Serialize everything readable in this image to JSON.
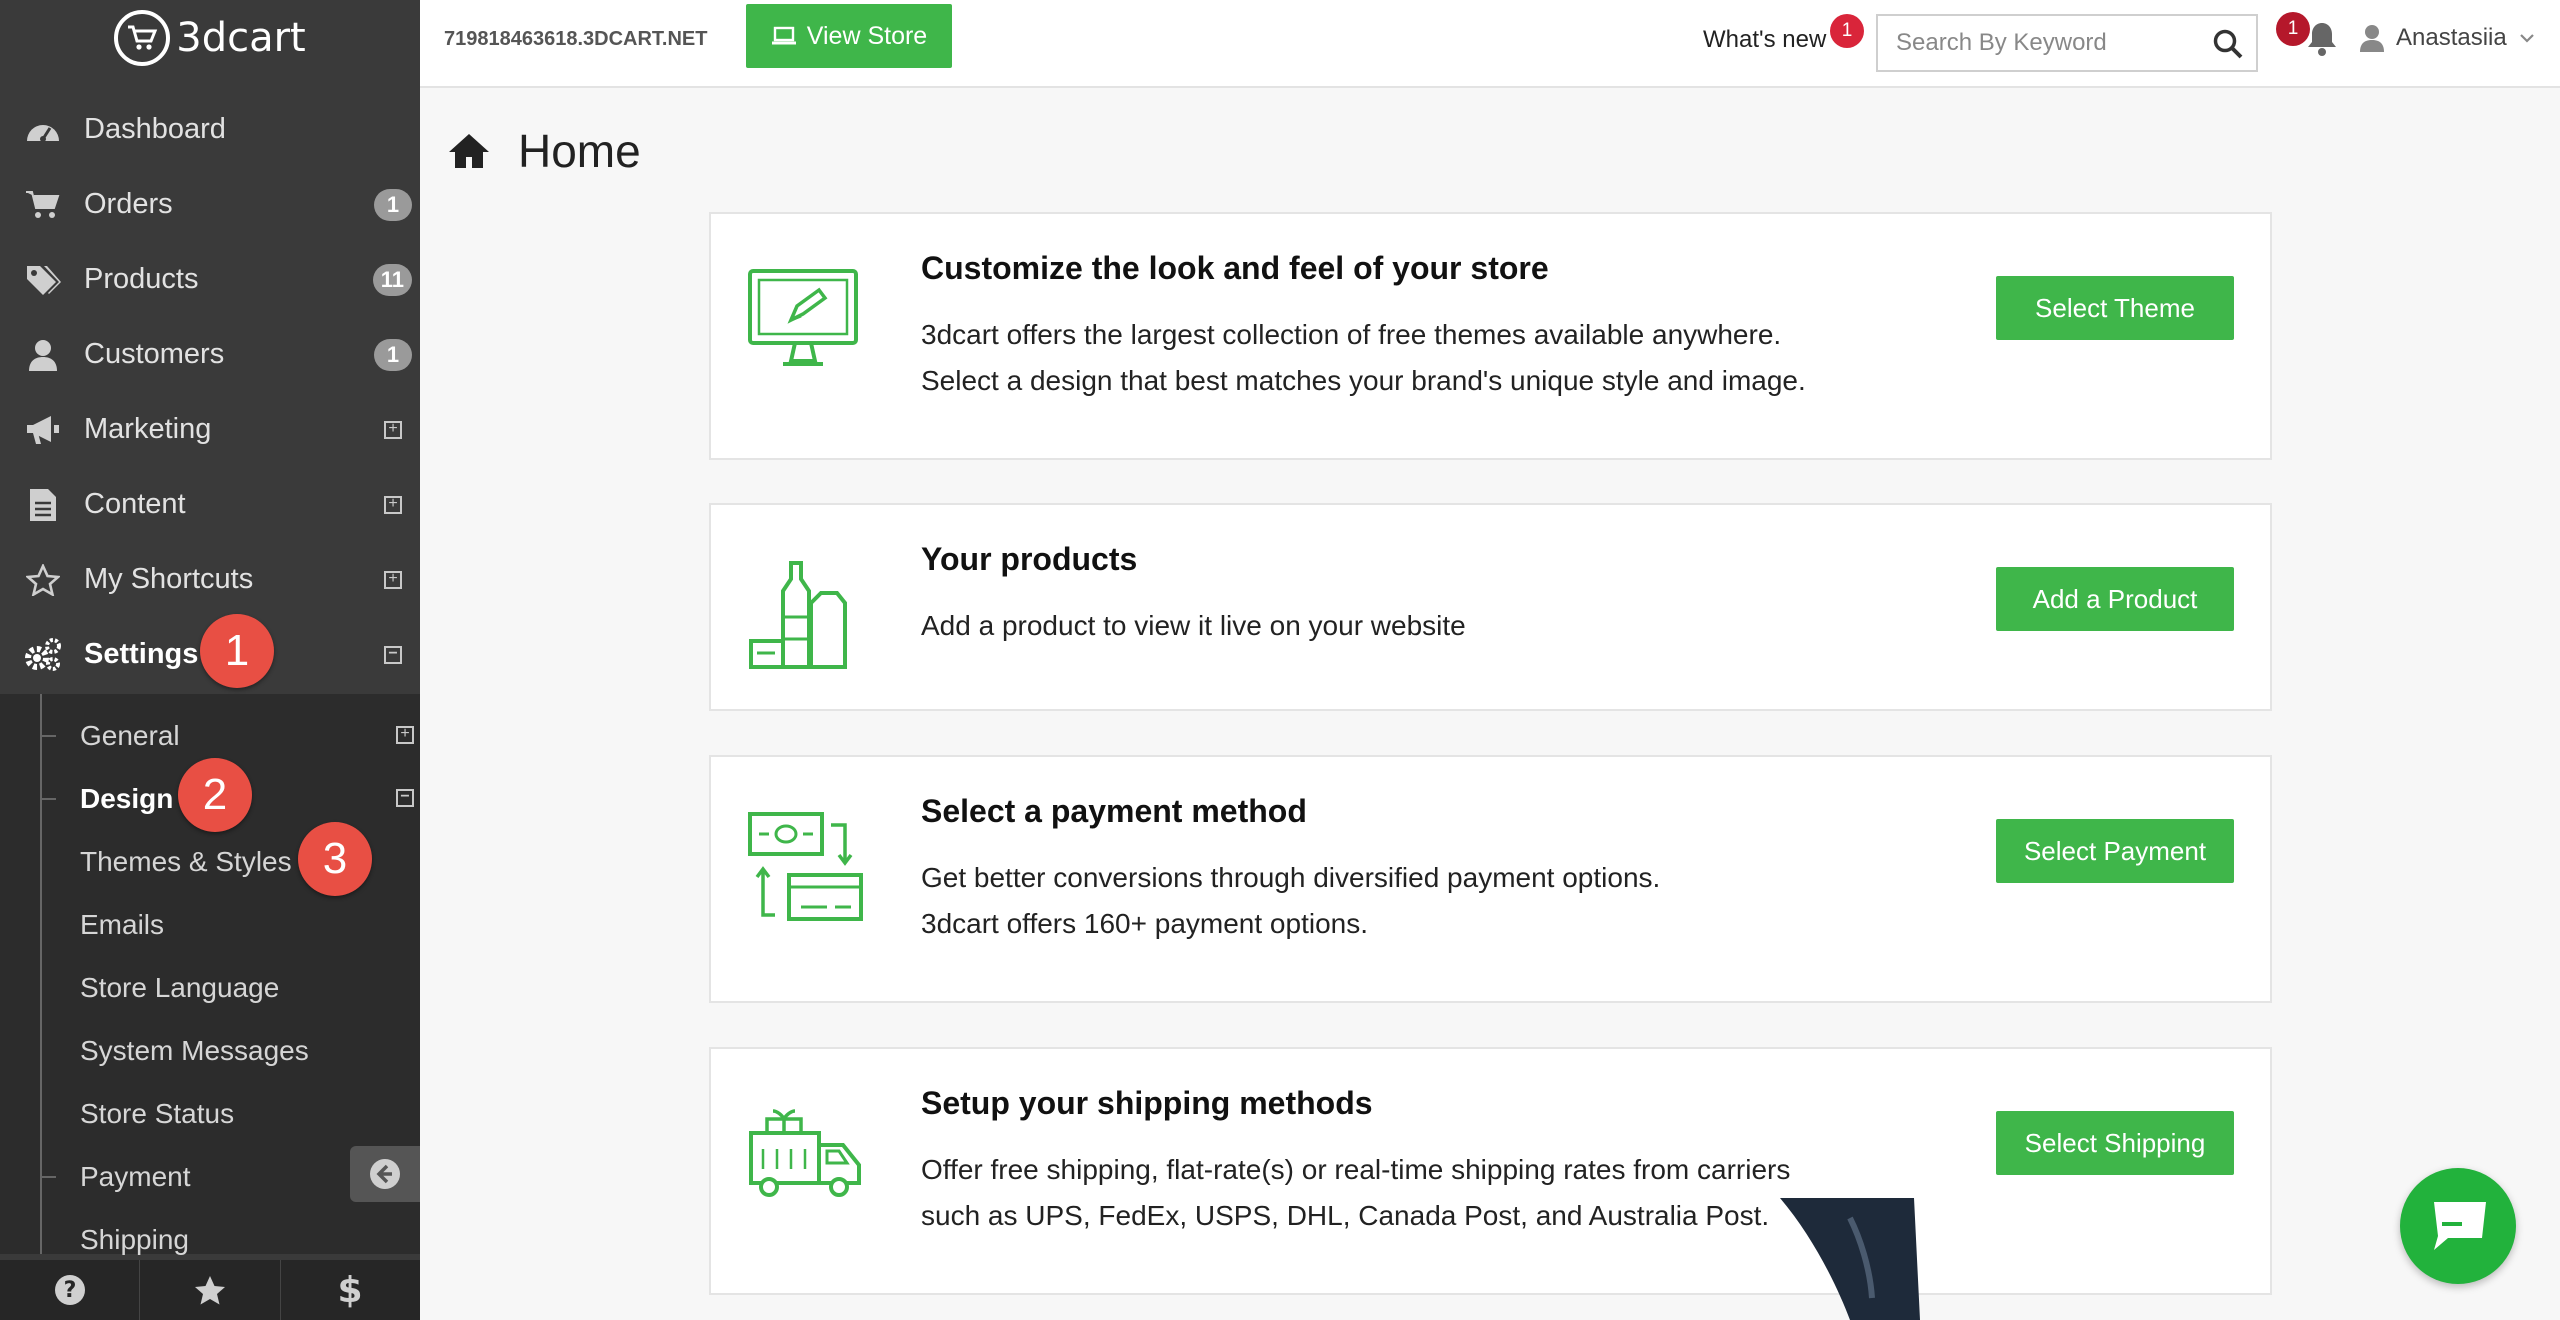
{
  "brand": {
    "logo_text": "3dcart"
  },
  "topbar": {
    "store_url": "719818463618.3DCART.NET",
    "view_store_label": "View Store",
    "whats_new_label": "What's new",
    "whats_new_count": "1",
    "search_placeholder": "Search By Keyword",
    "notifications_count": "1",
    "user_name": "Anastasiia"
  },
  "sidebar": {
    "items": [
      {
        "label": "Dashboard",
        "icon": "dashboard-icon"
      },
      {
        "label": "Orders",
        "icon": "cart-icon",
        "badge": "1"
      },
      {
        "label": "Products",
        "icon": "tags-icon",
        "badge": "11"
      },
      {
        "label": "Customers",
        "icon": "user-icon",
        "badge": "1"
      },
      {
        "label": "Marketing",
        "icon": "megaphone-icon"
      },
      {
        "label": "Content",
        "icon": "document-icon"
      },
      {
        "label": "My Shortcuts",
        "icon": "star-icon"
      },
      {
        "label": "Settings",
        "icon": "gears-icon"
      }
    ],
    "settings_sub": [
      "General",
      "Design",
      "Themes & Styles",
      "Emails",
      "Store Language",
      "System Messages",
      "Store Status",
      "Payment",
      "Shipping"
    ],
    "steps": [
      "1",
      "2",
      "3"
    ]
  },
  "main": {
    "title": "Home",
    "cards": [
      {
        "title": "Customize the look and feel of your store",
        "line1": "3dcart offers the largest collection of free themes available anywhere.",
        "line2": "Select a design that best matches your brand's unique style and image.",
        "cta": "Select Theme"
      },
      {
        "title": "Your products",
        "line1": "Add a product to view it live on your website",
        "line2": "",
        "cta": "Add a Product"
      },
      {
        "title": "Select a payment method",
        "line1": "Get better conversions through diversified payment options.",
        "line2": "3dcart offers 160+ payment options.",
        "cta": "Select Payment"
      },
      {
        "title": "Setup your shipping methods",
        "line1": "Offer free shipping, flat-rate(s) or real-time shipping rates from carriers",
        "line2": "such as UPS, FedEx, USPS, DHL, Canada Post, and Australia Post.",
        "cta": "Select Shipping"
      }
    ]
  },
  "colors": {
    "accent": "#3fb64a",
    "sidebar": "#3a3a3a",
    "step": "#e84f44",
    "alert": "#d9253a"
  }
}
